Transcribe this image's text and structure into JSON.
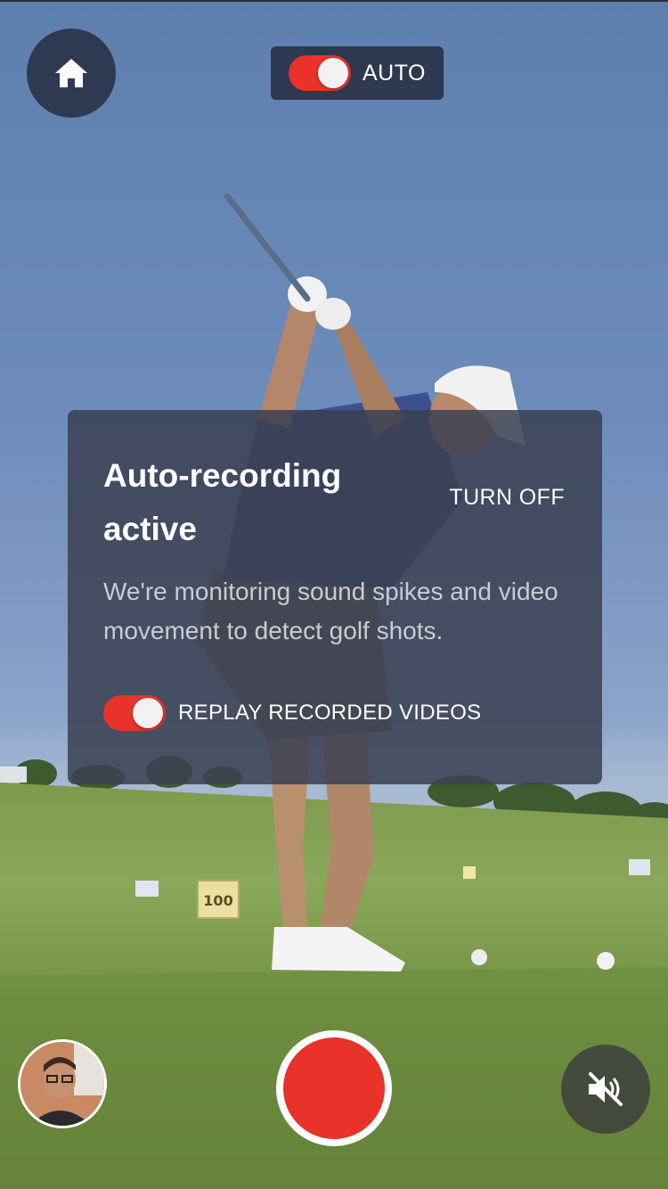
{
  "header": {
    "home_icon": "home-icon",
    "auto_toggle": {
      "label": "AUTO",
      "on": true,
      "color": "#e8322a"
    }
  },
  "card": {
    "title": "Auto-recording active",
    "turn_off_label": "TURN OFF",
    "description": "We're monitoring sound spikes and video movement to detect golf shots.",
    "replay_toggle": {
      "label": "REPLAY RECORDED VIDEOS",
      "on": true
    }
  },
  "footer": {
    "selfie_thumbnail": "front-camera-preview",
    "record_button": "record-button",
    "mute_icon": "volume-muted-icon",
    "record_color": "#e8322a"
  }
}
